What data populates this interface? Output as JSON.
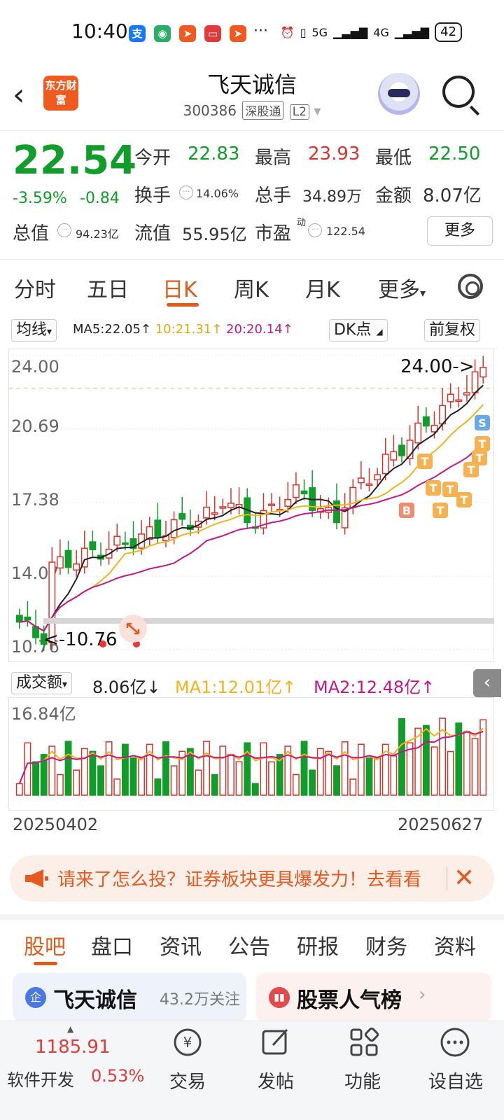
{
  "status_bar": {
    "time": "10:40",
    "signal_1": "5G",
    "signal_2": "4G",
    "battery": "42"
  },
  "header": {
    "brand": "东方财富",
    "stock_name": "飞天诚信",
    "stock_code": "300386",
    "exchange_tag": "深股通",
    "level_tag": "L2"
  },
  "quote": {
    "price": "22.54",
    "change_pct": "-3.59%",
    "change_amt": "-0.84",
    "open_label": "今开",
    "open": "22.83",
    "high_label": "最高",
    "high": "23.93",
    "low_label": "最低",
    "low": "22.50",
    "turnover_label": "换手",
    "turnover": "14.06%",
    "volume_label": "总手",
    "volume": "34.89万",
    "amount_label": "金额",
    "amount": "8.07亿",
    "mcap_label": "总值",
    "mcap": "94.23亿",
    "float_label": "流值",
    "float_cap": "55.95亿",
    "pe_label": "市盈",
    "pe_sup": "动",
    "pe": "122.54",
    "more_button": "更多"
  },
  "chart_tabs": [
    "分时",
    "五日",
    "日K",
    "周K",
    "月K",
    "更多"
  ],
  "indicator_bar": {
    "ma_selector": "均线",
    "ma5": "MA5:22.05↑",
    "ma10": "10:21.31↑",
    "ma20": "20:20.14↑",
    "dk_button": "DK点",
    "adjust_button": "前复权"
  },
  "kline": {
    "y_labels": [
      "24.00",
      "20.69",
      "17.38",
      "14.07",
      "10.76"
    ],
    "max_marker": "24.00->",
    "min_marker": "<-10.76",
    "signal_b": "B",
    "signal_t": "T",
    "signal_s": "S"
  },
  "volume": {
    "selector": "成交额",
    "current": "8.06亿↓",
    "ma1": "MA1:12.01亿↑",
    "ma2": "MA2:12.48亿↑",
    "y_max": "16.84亿"
  },
  "dates": {
    "start": "20250402",
    "end": "20250627"
  },
  "banner": {
    "text": "请来了怎么投？证券板块更具爆发力！去看看"
  },
  "section_tabs": [
    "股吧",
    "盘口",
    "资讯",
    "公告",
    "研报",
    "财务",
    "资料"
  ],
  "cards": {
    "forum_badge": "企",
    "forum_name": "飞天诚信",
    "forum_followers": "43.2万关注",
    "rank_title": "股票人气榜"
  },
  "bottom_bar": {
    "index_value": "1185.91",
    "index_name": "软件开发",
    "index_change": "0.53%",
    "trade": "交易",
    "post": "发帖",
    "functions": "功能",
    "watchlist": "设自选"
  },
  "colors": {
    "up": "#d9342b",
    "down": "#109d2a",
    "accent": "#e05a1a",
    "ma5": "#222222",
    "ma10": "#f2b418",
    "ma20": "#c2188a"
  }
}
